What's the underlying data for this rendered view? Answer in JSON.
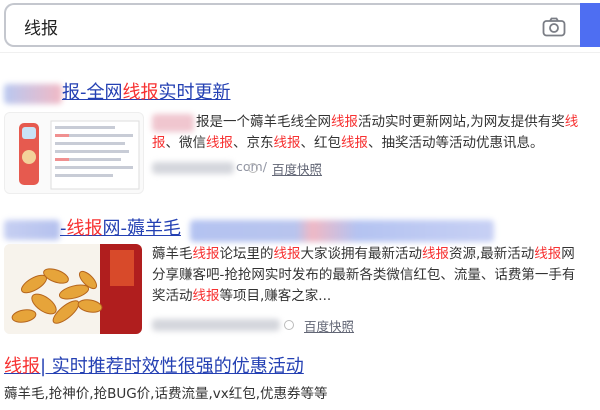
{
  "search": {
    "query": "线报",
    "icons": {
      "camera": "camera-icon",
      "submit": "search-submit"
    },
    "accent_color": "#4e6ef2"
  },
  "results": [
    {
      "title_suffix_1": "报-全网",
      "title_keyword": "线报",
      "title_suffix_2": "实时更新",
      "desc_line1_a": "报是一个薅羊毛线全网",
      "desc_line1_kw": "线报",
      "desc_line1_b": "活动实时更新网站,为网友提供有奖",
      "desc_line1_kw2": "线",
      "desc_line2_kw": "报",
      "desc_line2_a": "、微信",
      "desc_line2_kw2": "线报",
      "desc_line2_b": "、京东",
      "desc_line2_kw3": "线报",
      "desc_line2_c": "、红包",
      "desc_line2_kw4": "线报",
      "desc_line2_d": "、抽奖活动等活动优惠讯息。",
      "url_visible": "com/",
      "snapshot_label": "百度快照"
    },
    {
      "title_a": "-",
      "title_keyword": "线报",
      "title_b": "网-薅羊毛",
      "desc_line1_a": "薅羊毛",
      "desc_line1_kw": "线报",
      "desc_line1_b": "论坛里的",
      "desc_line1_kw2": "线报",
      "desc_line1_c": "大家谈拥有最新活动",
      "desc_line1_kw3": "线报",
      "desc_line1_d": "资源,最新活动",
      "desc_line1_kw4": "线报",
      "desc_line1_e": "网",
      "desc_line2": "分享赚客吧-抢抢网实时发布的最新各类微信红包、流量、话费第一手有",
      "desc_line3_a": "奖活动",
      "desc_line3_kw": "线报",
      "desc_line3_b": "等项目,赚客之家...",
      "snapshot_label": "百度快照"
    },
    {
      "title_keyword": "线报",
      "title_rest": "| 实时推荐时效性很强的优惠活动",
      "desc": "薅羊毛,抢神价,抢BUG价,话费流量,vx红包,优惠券等等"
    }
  ],
  "colors": {
    "link": "#2440b3",
    "highlight": "#f73131",
    "meta": "#9195a3"
  }
}
